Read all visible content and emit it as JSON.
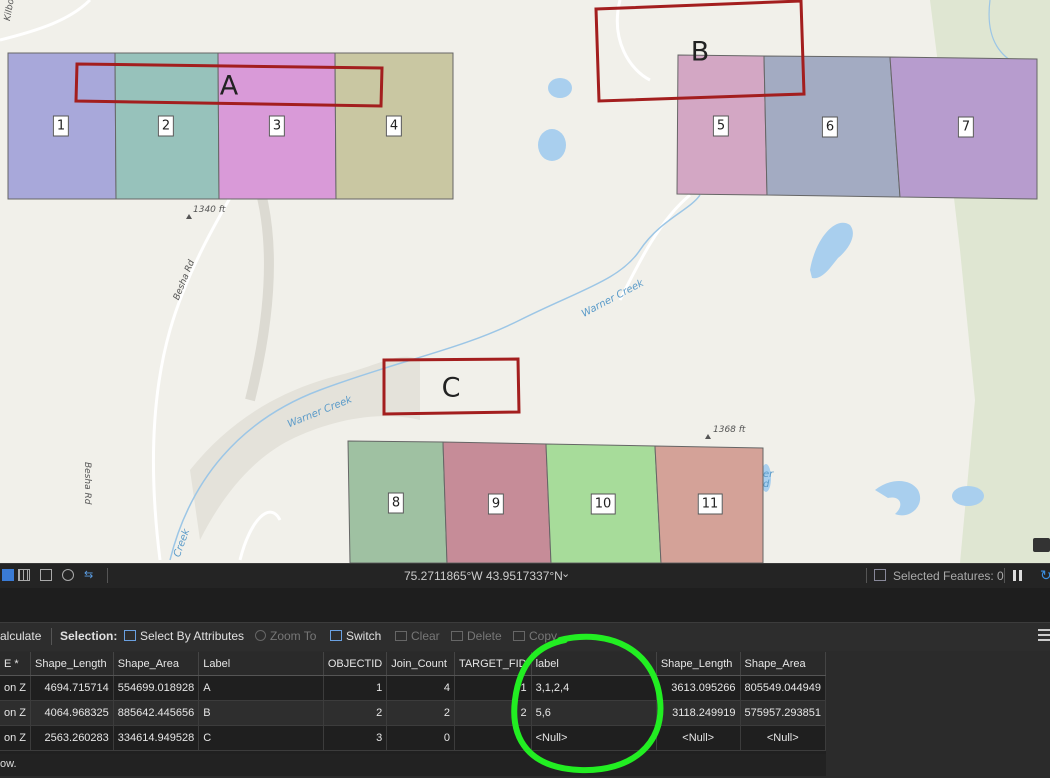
{
  "map": {
    "polygons": [
      "1",
      "2",
      "3",
      "4",
      "5",
      "6",
      "7",
      "8",
      "9",
      "10",
      "11"
    ],
    "zones": [
      "A",
      "B",
      "C"
    ],
    "labels": {
      "elev1": "1340 ft",
      "elev2": "1368 ft",
      "road1": "Besha Rd",
      "road2": "Besha Rd",
      "creek1": "Warner Creek",
      "creek2": "Warner Creek",
      "creek3": "Creek",
      "top_road": "Kilbo",
      "edge_text": "er\nd"
    },
    "colors": {
      "p1": "#a8a8da",
      "p2": "#97c2bb",
      "p3": "#d99ad8",
      "p4": "#c9c7a2",
      "p5": "#d3a7c4",
      "p6": "#a3abc2",
      "p7": "#b79cce",
      "p8": "#9fc1a2",
      "p9": "#c68c98",
      "p10": "#a7dc9a",
      "p11": "#d4a298",
      "zone_outline": "#a31e1e",
      "water": "#a9cfee",
      "circle": "#22ee22"
    }
  },
  "statusbar": {
    "coords": "75.2711865°W 43.9517337°N",
    "selected": "Selected Features: 0"
  },
  "toolbar": {
    "calculate": "alculate",
    "selection": "Selection:",
    "select_by_attributes": "Select By Attributes",
    "zoom_to": "Zoom To",
    "switch": "Switch",
    "clear": "Clear",
    "delete": "Delete",
    "copy": "Copy"
  },
  "table": {
    "headers": [
      "E *",
      "Shape_Length",
      "Shape_Area",
      "Label",
      "OBJECTID",
      "Join_Count",
      "TARGET_FID",
      "label",
      "Shape_Length",
      "Shape_Area"
    ],
    "rows": [
      [
        "on Z",
        "4694.715714",
        "554699.018928",
        "A",
        "1",
        "4",
        "1",
        "3,1,2,4",
        "3613.095266",
        "805549.044949"
      ],
      [
        "on Z",
        "4064.968325",
        "885642.445656",
        "B",
        "2",
        "2",
        "2",
        "5,6",
        "3118.249919",
        "575957.293851"
      ],
      [
        "on Z",
        "2563.260283",
        "334614.949528",
        "C",
        "3",
        "0",
        "",
        "<Null>",
        "<Null>",
        "<Null>"
      ]
    ],
    "footer": "ow."
  }
}
